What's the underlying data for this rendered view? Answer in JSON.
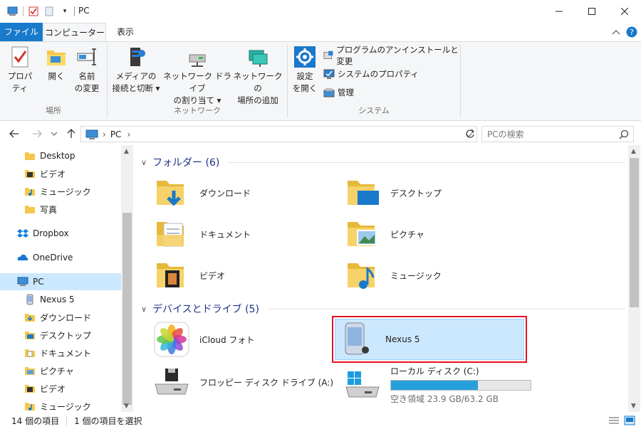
{
  "window": {
    "title": "PC"
  },
  "ribbon_tabs": {
    "file": "ファイル",
    "computer": "コンピューター",
    "view": "表示"
  },
  "ribbon": {
    "location": {
      "label": "場所",
      "properties": "プロパティ",
      "open": "開く",
      "rename_1": "名前",
      "rename_2": "の変更"
    },
    "network": {
      "label": "ネットワーク",
      "media_1": "メディアの",
      "media_2": "接続と切断",
      "map_1": "ネットワーク ドライブ",
      "map_2": "の割り当て",
      "add_1": "ネットワークの",
      "add_2": "場所の追加"
    },
    "system": {
      "label": "システム",
      "settings_1": "設定",
      "settings_2": "を開く",
      "uninstall": "プログラムのアンインストールと変更",
      "sysprops": "システムのプロパティ",
      "manage": "管理"
    }
  },
  "address": {
    "path": [
      "PC"
    ],
    "search_placeholder": "PCの検索"
  },
  "nav": {
    "items": [
      {
        "label": "Desktop",
        "icon": "folder-icon"
      },
      {
        "label": "ビデオ",
        "icon": "video-folder-icon"
      },
      {
        "label": "ミュージック",
        "icon": "music-folder-icon"
      },
      {
        "label": "写真",
        "icon": "folder-icon"
      },
      {
        "label": "Dropbox",
        "icon": "dropbox-icon"
      },
      {
        "label": "OneDrive",
        "icon": "onedrive-icon"
      },
      {
        "label": "PC",
        "icon": "pc-icon"
      },
      {
        "label": "Nexus 5",
        "icon": "phone-icon"
      },
      {
        "label": "ダウンロード",
        "icon": "download-folder-icon"
      },
      {
        "label": "デスクトップ",
        "icon": "desktop-folder-icon"
      },
      {
        "label": "ドキュメント",
        "icon": "documents-folder-icon"
      },
      {
        "label": "ピクチャ",
        "icon": "pictures-folder-icon"
      },
      {
        "label": "ビデオ",
        "icon": "video-folder-icon"
      },
      {
        "label": "ミュージック",
        "icon": "music-folder-icon"
      }
    ]
  },
  "main": {
    "folders_header": "フォルダー (6)",
    "folders": [
      {
        "label": "ダウンロード",
        "icon": "download-folder-icon"
      },
      {
        "label": "デスクトップ",
        "icon": "desktop-folder-icon"
      },
      {
        "label": "ドキュメント",
        "icon": "documents-folder-icon"
      },
      {
        "label": "ピクチャ",
        "icon": "pictures-folder-icon"
      },
      {
        "label": "ビデオ",
        "icon": "video-folder-icon"
      },
      {
        "label": "ミュージック",
        "icon": "music-folder-icon"
      }
    ],
    "devices_header": "デバイスとドライブ (5)",
    "devices": [
      {
        "label": "iCloud フォト",
        "icon": "icloud-photos-icon"
      },
      {
        "label": "Nexus 5",
        "icon": "phone-icon"
      },
      {
        "label": "フロッピー ディスク ドライブ (A:)",
        "icon": "floppy-drive-icon"
      },
      {
        "label": "ローカル ディスク (C:)",
        "icon": "local-disk-icon",
        "used_fraction": 0.62,
        "free_text": "空き領域 23.9 GB/63.2 GB"
      }
    ]
  },
  "status": {
    "count": "14 個の項目",
    "selected": "1 個の項目を選択"
  },
  "colors": {
    "accent": "#1979ca",
    "selection": "#cce8ff",
    "highlight_box": "#e81123",
    "drive_fill": "#26a0da",
    "group_header": "#1e3287"
  }
}
